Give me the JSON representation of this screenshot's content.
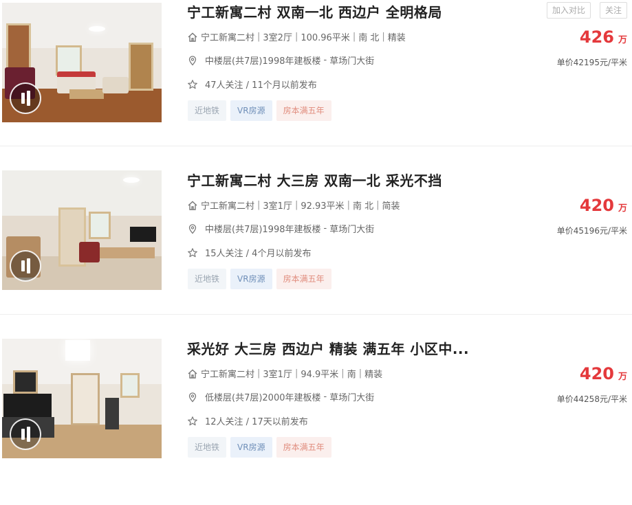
{
  "buttons": {
    "compare_label": "加入对比",
    "follow_label": "关注"
  },
  "listings": [
    {
      "title": "宁工新寓二村 双南一北 西边户 全明格局",
      "community": "宁工新寓二村",
      "layout": "3室2厅",
      "area": "100.96平米",
      "orientation": "南 北",
      "decoration": "精装",
      "floor_info": "中楼层(共7层)1998年建板楼",
      "district": "草场门大街",
      "follow_info": "47人关注 / 11个月以前发布",
      "tags": [
        "近地铁",
        "VR房源",
        "房本满五年"
      ],
      "total_price": "426",
      "price_unit": "万",
      "unit_price": "单价42195元/平米"
    },
    {
      "title": "宁工新寓二村 大三房 双南一北 采光不挡",
      "community": "宁工新寓二村",
      "layout": "3室1厅",
      "area": "92.93平米",
      "orientation": "南 北",
      "decoration": "简装",
      "floor_info": "中楼层(共7层)1998年建板楼",
      "district": "草场门大街",
      "follow_info": "15人关注 / 4个月以前发布",
      "tags": [
        "近地铁",
        "VR房源",
        "房本满五年"
      ],
      "total_price": "420",
      "price_unit": "万",
      "unit_price": "单价45196元/平米"
    },
    {
      "title": "采光好 大三房 西边户 精装 满五年 小区中...",
      "community": "宁工新寓二村",
      "layout": "3室1厅",
      "area": "94.9平米",
      "orientation": "南",
      "decoration": "精装",
      "floor_info": "低楼层(共7层)2000年建板楼",
      "district": "草场门大街",
      "follow_info": "12人关注 / 17天以前发布",
      "tags": [
        "近地铁",
        "VR房源",
        "房本满五年"
      ],
      "total_price": "420",
      "price_unit": "万",
      "unit_price": "单价44258元/平米"
    }
  ]
}
